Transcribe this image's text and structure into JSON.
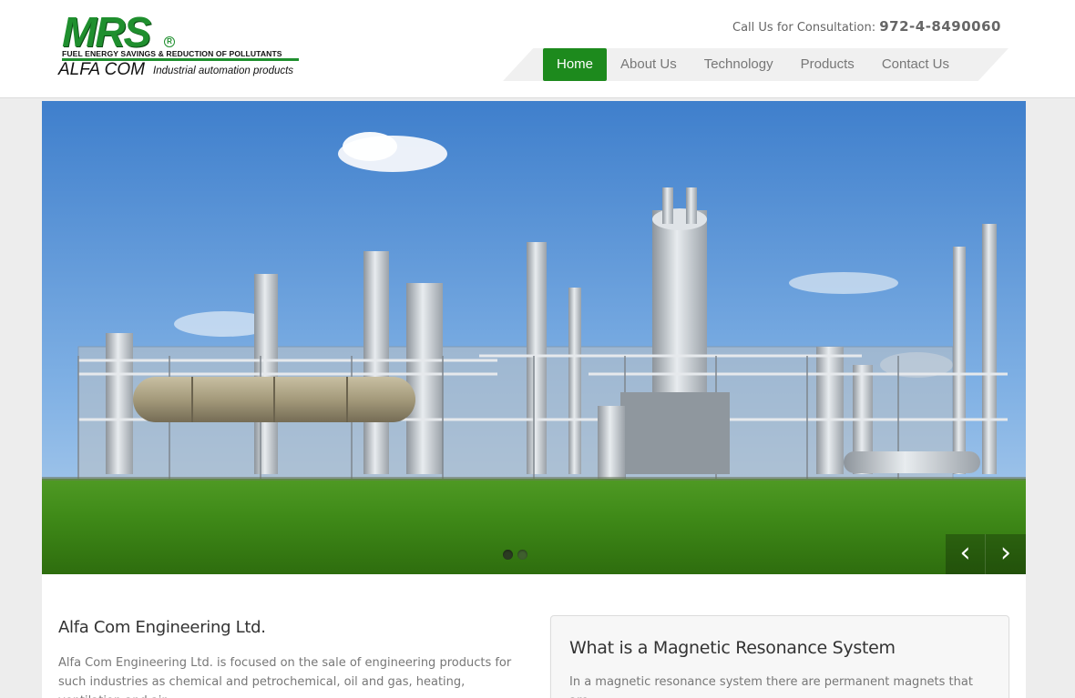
{
  "logo": {
    "mrs": "MRS",
    "registered": "R",
    "tagline": "FUEL ENERGY SAVINGS & REDUCTION OF POLLUTANTS",
    "company": "ALFA COM",
    "company_sub": "Industrial automation products"
  },
  "consultation": {
    "label": "Call Us for Consultation:",
    "phone": "972-4-8490060"
  },
  "nav": {
    "items": [
      "Home",
      "About Us",
      "Technology",
      "Products",
      "Contact Us"
    ],
    "active": "Home",
    "accent_color": "#1d8a1d"
  },
  "slider": {
    "image": "industrial-plant-photo",
    "prev_icon": "chevron-left-icon",
    "next_icon": "chevron-right-icon",
    "prev_glyph": "‹",
    "next_glyph": "›",
    "slide_count": 2,
    "current_slide": 1
  },
  "intro": {
    "title": "Alfa Com Engineering Ltd.",
    "text": "Alfa Com Engineering Ltd. is focused on the sale of engineering products for such industries as chemical and petrochemical, oil and gas, heating, ventilation and air-"
  },
  "feature": {
    "title": "What is a Magnetic Resonance System",
    "text": "In a magnetic resonance system there are permanent magnets that are"
  }
}
